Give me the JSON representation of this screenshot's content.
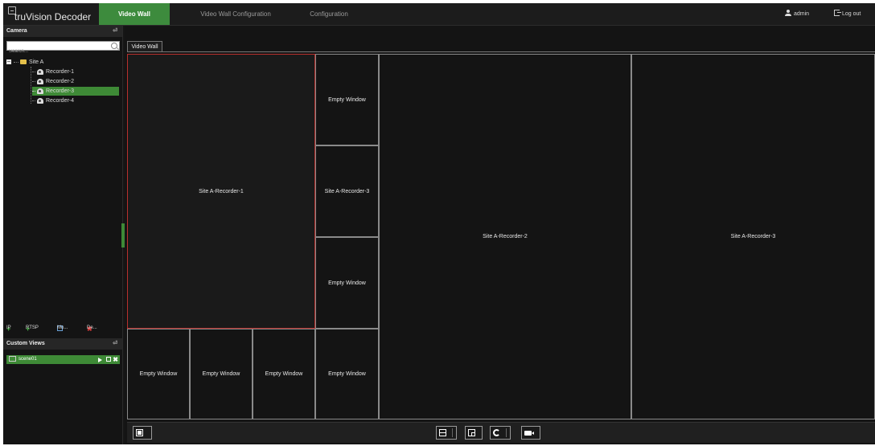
{
  "app": {
    "name": "truVision Decoder"
  },
  "nav": {
    "tabs": [
      {
        "label": "Video Wall",
        "active": true
      },
      {
        "label": "Video Wall Configuration",
        "active": false
      },
      {
        "label": "Configuration",
        "active": false
      }
    ],
    "user": "admin",
    "logout": "Log out"
  },
  "camera_panel": {
    "title": "Camera",
    "collapse": "⏎",
    "search_placeholder": "Search...",
    "site": "Site A",
    "recorders": [
      "Recorder-1",
      "Recorder-2",
      "Recorder-3",
      "Recorder-4"
    ],
    "selected_recorder": "Recorder-3",
    "actions": {
      "ip": "IP",
      "rtsp": "RTSP",
      "modify": "Mo...",
      "delete": "De..."
    }
  },
  "custom_views": {
    "title": "Custom Views",
    "collapse": "⏎",
    "items": [
      {
        "label": "scene01"
      }
    ]
  },
  "video_wall": {
    "tab_label": "Video Wall",
    "windows": {
      "big": "Site A-Recorder-1",
      "c1": "Empty Window",
      "c2": "Site A-Recorder-3",
      "c3": "Empty Window",
      "b1": "Empty Window",
      "b2": "Empty Window",
      "b3": "Empty Window",
      "b4": "Empty Window",
      "m1": "Site A-Recorder-2",
      "m2": "Site A-Recorder-3"
    }
  },
  "colors": {
    "accent": "#3d8b3d",
    "selected_border": "#b8302d",
    "background": "#161616"
  }
}
